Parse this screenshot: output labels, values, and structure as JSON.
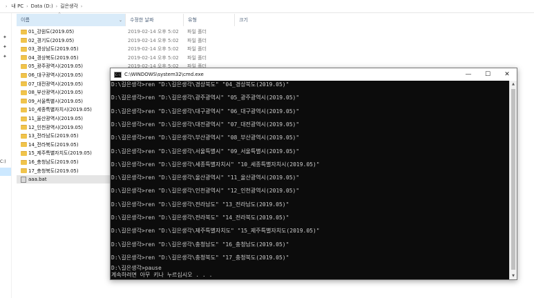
{
  "breadcrumb": {
    "items": [
      "내 PC",
      "Data (D:)",
      "길은생각"
    ]
  },
  "columns": {
    "name": "이름",
    "date": "수정한 날짜",
    "type": "유형",
    "size": "크기"
  },
  "nav": {
    "drive_label": "C:)"
  },
  "files": [
    {
      "name": "01_강원도(2019.05)",
      "date": "2019-02-14 오후 5:02",
      "type": "파일 폴더",
      "kind": "folder"
    },
    {
      "name": "02_경기도(2019.05)",
      "date": "2019-02-14 오후 5:02",
      "type": "파일 폴더",
      "kind": "folder"
    },
    {
      "name": "03_경상남도(2019.05)",
      "date": "2019-02-14 오후 5:02",
      "type": "파일 폴더",
      "kind": "folder"
    },
    {
      "name": "04_경상북도(2019.05)",
      "date": "2019-02-14 오후 5:02",
      "type": "파일 폴더",
      "kind": "folder"
    },
    {
      "name": "05_광주광역시(2019.05)",
      "date": "2019-02-14 오후 5:02",
      "type": "파일 폴더",
      "kind": "folder"
    },
    {
      "name": "06_대구광역시(2019.05)",
      "date": "",
      "type": "",
      "kind": "folder"
    },
    {
      "name": "07_대전광역시(2019.05)",
      "date": "",
      "type": "",
      "kind": "folder"
    },
    {
      "name": "08_부산광역시(2019.05)",
      "date": "",
      "type": "",
      "kind": "folder"
    },
    {
      "name": "09_서울특별시(2019.05)",
      "date": "",
      "type": "",
      "kind": "folder"
    },
    {
      "name": "10_세종특별자치시(2019.05)",
      "date": "",
      "type": "",
      "kind": "folder"
    },
    {
      "name": "11_울산광역시(2019.05)",
      "date": "",
      "type": "",
      "kind": "folder"
    },
    {
      "name": "12_인천광역시(2019.05)",
      "date": "",
      "type": "",
      "kind": "folder"
    },
    {
      "name": "13_전라남도(2019.05)",
      "date": "",
      "type": "",
      "kind": "folder"
    },
    {
      "name": "14_전라북도(2019.05)",
      "date": "",
      "type": "",
      "kind": "folder"
    },
    {
      "name": "15_제주특별자치도(2019.05)",
      "date": "",
      "type": "",
      "kind": "folder"
    },
    {
      "name": "16_충청남도(2019.05)",
      "date": "",
      "type": "",
      "kind": "folder"
    },
    {
      "name": "17_충청북도(2019.05)",
      "date": "",
      "type": "",
      "kind": "folder"
    },
    {
      "name": "aaa.bat",
      "date": "",
      "type": "",
      "kind": "file"
    }
  ],
  "cmd": {
    "title": "C:\\WINDOWS\\system32\\cmd.exe",
    "lines": [
      "D:\\길은생각>ren \"D:\\길은생각\\경상북도\" \"04_경상북도(2019.05)\"",
      "D:\\길은생각>ren \"D:\\길은생각\\광주광역시\" \"05_광주광역시(2019.05)\"",
      "D:\\길은생각>ren \"D:\\길은생각\\대구광역시\" \"06_대구광역시(2019.05)\"",
      "D:\\길은생각>ren \"D:\\길은생각\\대전광역시\" \"07_대전광역시(2019.05)\"",
      "D:\\길은생각>ren \"D:\\길은생각\\부산광역시\" \"08_부산광역시(2019.05)\"",
      "D:\\길은생각>ren \"D:\\길은생각\\서울특별시\" \"09_서울특별시(2019.05)\"",
      "D:\\길은생각>ren \"D:\\길은생각\\세종특별자치시\" \"10_세종특별자치시(2019.05)\"",
      "D:\\길은생각>ren \"D:\\길은생각\\울산광역시\" \"11_울산광역시(2019.05)\"",
      "D:\\길은생각>ren \"D:\\길은생각\\인천광역시\" \"12_인천광역시(2019.05)\"",
      "D:\\길은생각>ren \"D:\\길은생각\\전라남도\" \"13_전라남도(2019.05)\"",
      "D:\\길은생각>ren \"D:\\길은생각\\전라북도\" \"14_전라북도(2019.05)\"",
      "D:\\길은생각>ren \"D:\\길은생각\\제주특별자치도\" \"15_제주특별자치도(2019.05)\"",
      "D:\\길은생각>ren \"D:\\길은생각\\충청남도\" \"16_충청남도(2019.05)\"",
      "D:\\길은생각>ren \"D:\\길은생각\\충청북도\" \"17_충청북도(2019.05)\"",
      "D:\\길은생각>pause",
      "계속하려면 아무 키나 누르십시오 . . ."
    ]
  }
}
